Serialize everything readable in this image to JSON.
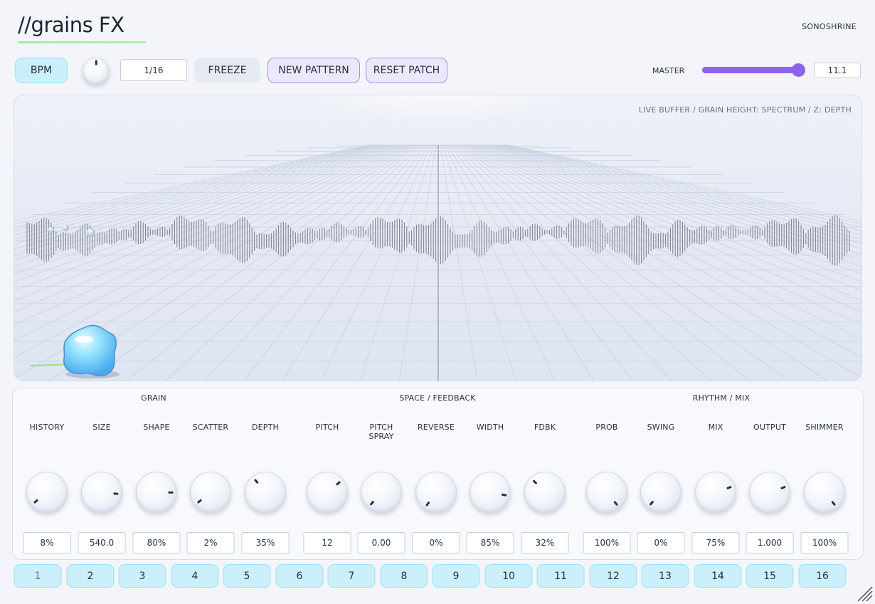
{
  "header": {
    "title": "//grains FX",
    "brand": "SONOSHRINE"
  },
  "toolbar": {
    "bpm_label": "BPM",
    "rate_value": "1/16",
    "freeze_label": "FREEZE",
    "new_pattern_label": "NEW PATTERN",
    "reset_patch_label": "RESET PATCH",
    "master_label": "MASTER",
    "master_value": "11.1",
    "master_level": 0.93
  },
  "colors": {
    "accent_purple": "#8e63ea",
    "accent_cyan": "#c9f0fb",
    "title_underline": "#a8e8a0"
  },
  "visualizer": {
    "label": "LIVE BUFFER / GRAIN HEIGHT: SPECTRUM / Z: DEPTH"
  },
  "sections": {
    "grain": "GRAIN",
    "space": "SPACE / FEEDBACK",
    "rhythm": "RHYTHM / MIX"
  },
  "params": [
    {
      "label": "HISTORY",
      "value": "8%"
    },
    {
      "label": "SIZE",
      "value": "540.0"
    },
    {
      "label": "SHAPE",
      "value": "80%"
    },
    {
      "label": "SCATTER",
      "value": "2%"
    },
    {
      "label": "DEPTH",
      "value": "35%"
    },
    {
      "label": "PITCH",
      "value": "12"
    },
    {
      "label": "PITCH SPRAY",
      "value": "0.00"
    },
    {
      "label": "REVERSE",
      "value": "0%"
    },
    {
      "label": "WIDTH",
      "value": "85%"
    },
    {
      "label": "FDBK",
      "value": "32%"
    },
    {
      "label": "PROB",
      "value": "100%"
    },
    {
      "label": "SWING",
      "value": "0%"
    },
    {
      "label": "MIX",
      "value": "75%"
    },
    {
      "label": "OUTPUT",
      "value": "1.000"
    },
    {
      "label": "SHIMMER",
      "value": "100%"
    }
  ],
  "steps": [
    "1",
    "2",
    "3",
    "4",
    "5",
    "6",
    "7",
    "8",
    "9",
    "10",
    "11",
    "12",
    "13",
    "14",
    "15",
    "16"
  ],
  "active_step": "1"
}
